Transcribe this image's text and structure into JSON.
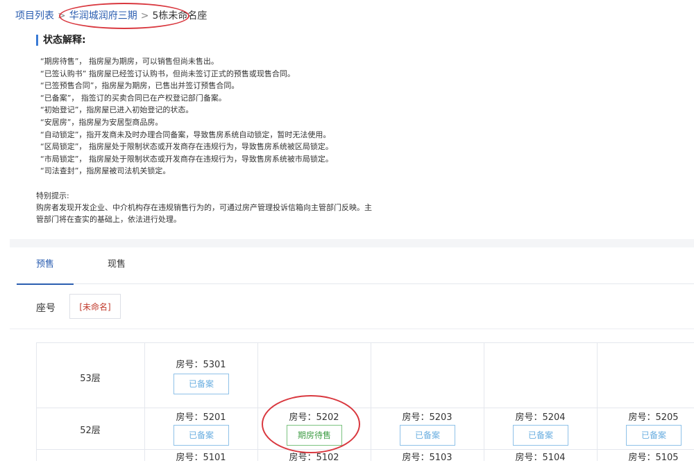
{
  "breadcrumb": {
    "root": "项目列表",
    "project": "华润城润府三期",
    "building": "5栋未命名座"
  },
  "explain": {
    "title": "状态解释:",
    "items": [
      "“期房待售”， 指房屋为期房，可以销售但尚未售出。",
      "“已签认购书” 指房屋已经签订认购书，但尚未签订正式的预售或现售合同。",
      "“已签预售合同”，指房屋为期房，已售出并签订预售合同。",
      "“已备案”， 指签订的买卖合同已在产权登记部门备案。",
      "“初始登记”，指房屋已进入初始登记的状态。",
      "“安居房”，指房屋为安居型商品房。",
      "“自动锁定”，指开发商未及时办理合同备案，导致售房系统自动锁定，暂时无法使用。",
      "“区局锁定”， 指房屋处于限制状态或开发商存在违规行为，导致售房系统被区局锁定。",
      "“市局锁定”， 指房屋处于限制状态或开发商存在违规行为，导致售房系统被市局锁定。",
      "“司法查封”，指房屋被司法机关锁定。"
    ],
    "notice_title": "特别提示:",
    "notice_text": "购房者发现开发企业、中介机构存在违规销售行为的，可通过房产管理投诉信箱向主管部门反映。主管部门将在查实的基础上，依法进行处理。"
  },
  "tabs": {
    "presale": "预售",
    "spot": "现售"
  },
  "seat": {
    "label": "座号",
    "value": "[未命名]"
  },
  "grid": {
    "floors": [
      "53层",
      "52层"
    ],
    "room_prefix": "房号：",
    "row53": {
      "room": "5301",
      "status": "已备案"
    },
    "row52": [
      {
        "room": "5201",
        "status": "已备案"
      },
      {
        "room": "5202",
        "status": "期房待售"
      },
      {
        "room": "5203",
        "status": "已备案"
      },
      {
        "room": "5204",
        "status": "已备案"
      },
      {
        "room": "5205",
        "status": "已备案"
      }
    ],
    "row51": [
      "房号：5101",
      "房号：5102",
      "房号：5103",
      "房号：5104",
      "房号：5105"
    ]
  },
  "colors": {
    "link": "#2a5db0",
    "annotation": "#d9383f",
    "filed_badge": "#6aaee0",
    "presale_badge": "#3f9d45"
  }
}
